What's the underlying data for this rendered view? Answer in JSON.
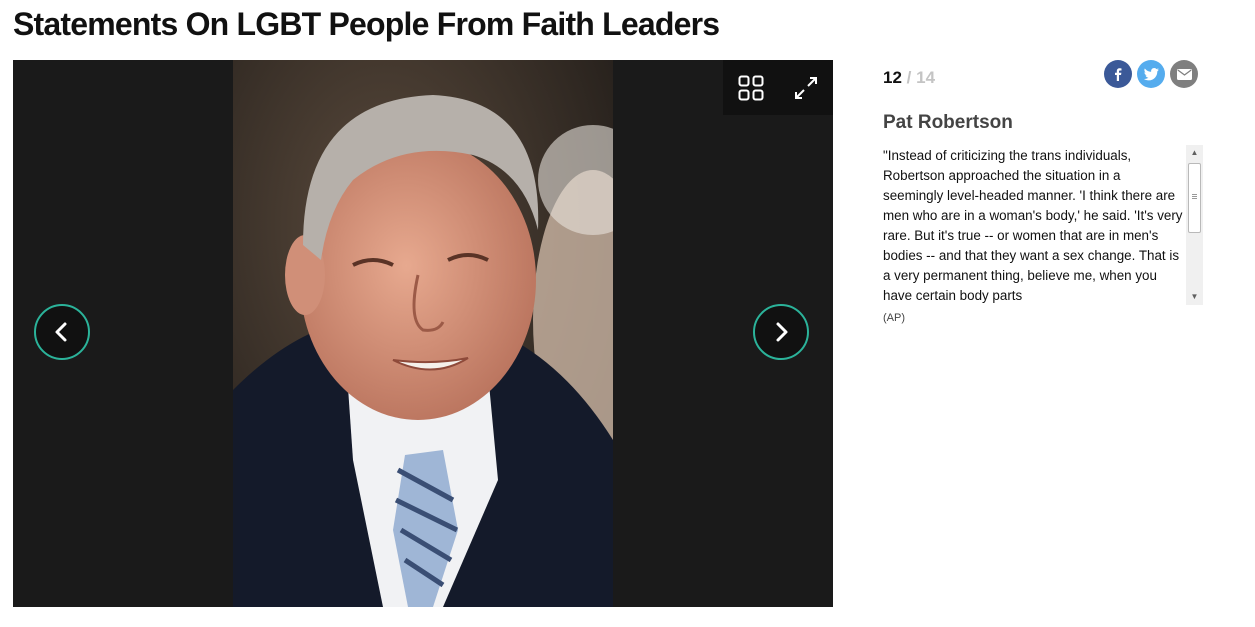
{
  "page": {
    "title": "Statements On LGBT People From Faith Leaders"
  },
  "gallery": {
    "current": "12",
    "separator": "/",
    "total": "14",
    "person_name": "Pat Robertson",
    "caption": "\"Instead of criticizing the trans individuals, Robertson approached the situation in a seemingly level-headed manner. 'I think there are men who are in a woman's body,' he said. 'It's very rare. But it's true -- or women that are in men's bodies -- and that they want a sex change. That is a very permanent thing, believe me, when you have certain body parts",
    "credit": "(AP)",
    "toolbar": {
      "grid_icon": "grid-view-icon",
      "expand_icon": "fullscreen-expand-icon"
    },
    "nav": {
      "prev_icon": "chevron-left-icon",
      "next_icon": "chevron-right-icon"
    },
    "share": [
      {
        "name": "facebook-icon",
        "color": "#3b5998"
      },
      {
        "name": "twitter-icon",
        "color": "#55acee"
      },
      {
        "name": "email-icon",
        "color": "#7f7f7f"
      }
    ],
    "accent_color": "#2bb39a"
  }
}
